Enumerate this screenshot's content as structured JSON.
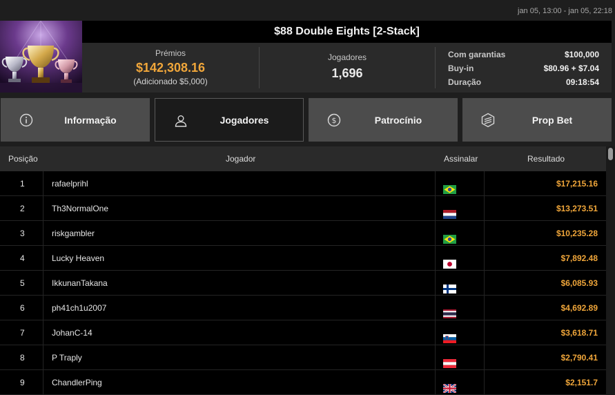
{
  "header": {
    "date_range": "jan 05, 13:00 - jan 05, 22:18",
    "title": "$88 Double Eights [2-Stack]"
  },
  "stats": {
    "prizes_label": "Prémios",
    "prizes_value": "$142,308.16",
    "prizes_added": "(Adicionado $5,000)",
    "players_label": "Jogadores",
    "players_value": "1,696",
    "guaranteed_label": "Com garantias",
    "guaranteed_value": "$100,000",
    "buyin_label": "Buy-in",
    "buyin_value": "$80.96 + $7.04",
    "duration_label": "Duração",
    "duration_value": "09:18:54"
  },
  "tabs": [
    {
      "label": "Informação",
      "icon": "info-icon",
      "active": false
    },
    {
      "label": "Jogadores",
      "icon": "user-icon",
      "active": true
    },
    {
      "label": "Patrocínio",
      "icon": "dollar-coin-icon",
      "active": false
    },
    {
      "label": "Prop Bet",
      "icon": "hexagon-bet-icon",
      "active": false
    }
  ],
  "table": {
    "columns": [
      "Posição",
      "Jogador",
      "Assinalar",
      "Resultado"
    ],
    "rows": [
      {
        "pos": "1",
        "player": "rafaelprihl",
        "flag": "brazil",
        "result": "$17,215.16"
      },
      {
        "pos": "2",
        "player": "Th3NormalOne",
        "flag": "netherlands",
        "result": "$13,273.51"
      },
      {
        "pos": "3",
        "player": "riskgambler",
        "flag": "brazil",
        "result": "$10,235.28"
      },
      {
        "pos": "4",
        "player": "Lucky Heaven",
        "flag": "japan",
        "result": "$7,892.48"
      },
      {
        "pos": "5",
        "player": "IkkunanTakana",
        "flag": "finland",
        "result": "$6,085.93"
      },
      {
        "pos": "6",
        "player": "ph41ch1u2007",
        "flag": "thailand",
        "result": "$4,692.89"
      },
      {
        "pos": "7",
        "player": "JohanC-14",
        "flag": "slovenia",
        "result": "$3,618.71"
      },
      {
        "pos": "8",
        "player": "P Traply",
        "flag": "austria",
        "result": "$2,790.41"
      },
      {
        "pos": "9",
        "player": "ChandlerPing",
        "flag": "united-kingdom",
        "result": "$2,151.7"
      }
    ]
  },
  "colors": {
    "accent": "#f0a63a",
    "background": "#1e1e1e",
    "tab_inactive": "#4c4c4c",
    "row_bg": "#000000"
  }
}
